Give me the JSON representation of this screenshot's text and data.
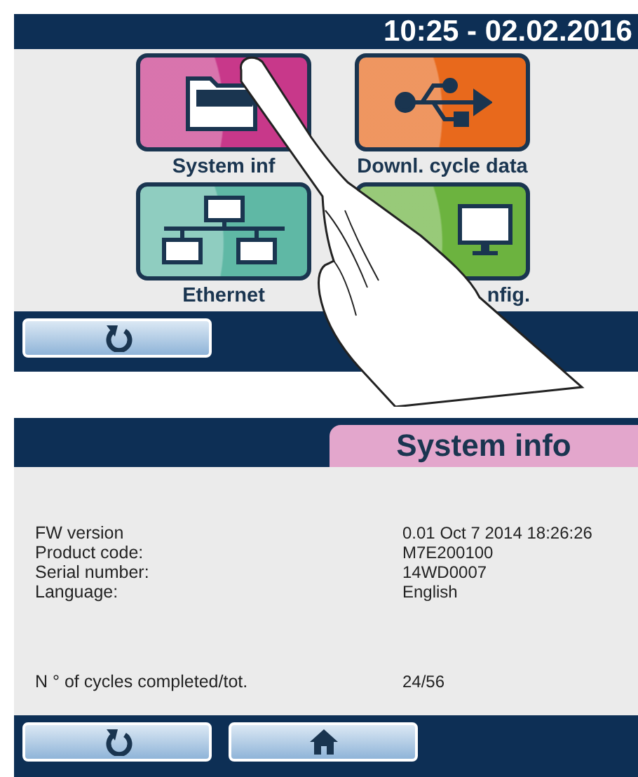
{
  "home_screen": {
    "clock": "10:25 - 02.02.2016",
    "tiles": [
      {
        "kind": "folder",
        "label": "System inf",
        "color": "#c8388a"
      },
      {
        "kind": "usb",
        "label": "Downl. cycle data",
        "color": "#e8691c"
      },
      {
        "kind": "network",
        "label": "Ethernet",
        "color": "#5fb8a5"
      },
      {
        "kind": "monitor",
        "label": "nfig.",
        "color": "#6cb33f"
      }
    ],
    "buttons": [
      {
        "kind": "back"
      }
    ]
  },
  "info_screen": {
    "title": "System info",
    "rows": [
      {
        "label": "FW version",
        "value": "0.01 Oct 7 2014 18:26:26"
      },
      {
        "label": "Product code:",
        "value": "M7E200100"
      },
      {
        "label": "Serial number:",
        "value": "14WD0007"
      },
      {
        "label": "Language:",
        "value": "English"
      }
    ],
    "cycles": {
      "label": "N ° of cycles completed/tot.",
      "value": "24/56"
    },
    "buttons": [
      {
        "kind": "back"
      },
      {
        "kind": "home"
      }
    ]
  }
}
